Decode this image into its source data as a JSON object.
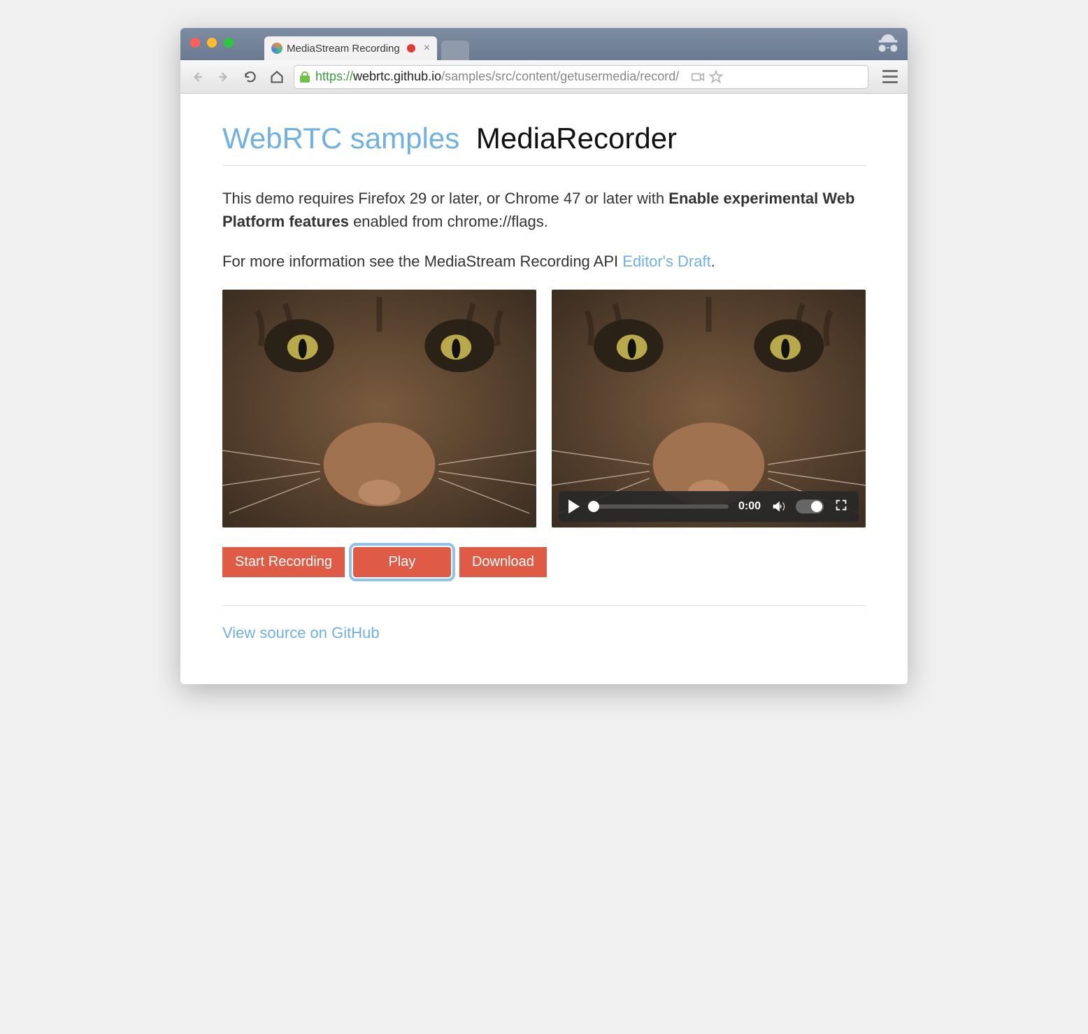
{
  "browser": {
    "tab_title": "MediaStream Recording",
    "url": {
      "scheme": "https://",
      "host": "webrtc.github.io",
      "path": "/samples/src/content/getusermedia/record/"
    }
  },
  "header": {
    "link_text": "WebRTC samples",
    "title_text": "MediaRecorder"
  },
  "intro": {
    "p1_a": "This demo requires Firefox 29 or later, or Chrome 47 or later with ",
    "p1_b": "Enable experimental Web Platform features",
    "p1_c": " enabled from chrome://flags.",
    "p2_a": "For more information see the MediaStream Recording API ",
    "p2_link": "Editor's Draft",
    "p2_b": "."
  },
  "video_controls": {
    "time": "0:00"
  },
  "buttons": {
    "start": "Start Recording",
    "play": "Play",
    "download": "Download"
  },
  "footer": {
    "source_link": "View source on GitHub"
  }
}
